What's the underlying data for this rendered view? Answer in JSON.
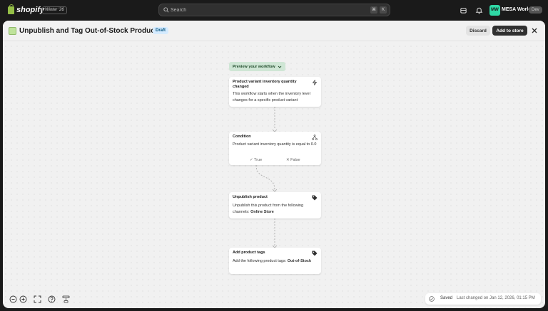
{
  "topbar": {
    "brand": "shopify",
    "version": "Winter '26",
    "search": {
      "placeholder": "Search",
      "shortcut_1": "⌘",
      "shortcut_2": "K"
    },
    "store": {
      "initials": "MW",
      "name": "MESA World",
      "badge": "Dev"
    }
  },
  "header": {
    "title": "Unpublish and Tag Out-of-Stock Products",
    "status": "Draft",
    "discard_label": "Discard",
    "add_label": "Add to store"
  },
  "canvas": {
    "preview_label": "Preview your workflow",
    "nodes": [
      {
        "title": "Product variant inventory quantity changed",
        "description": "This workflow starts when the inventory level changes for a specific product variant",
        "icon": "lightning-icon"
      },
      {
        "title": "Condition",
        "description": "Product variant inventory quantity is equal to 0.0",
        "icon": "branch-icon",
        "branches": {
          "true_label": "True",
          "false_label": "False"
        }
      },
      {
        "title": "Unpublish product",
        "description_prefix": "Unpublish this product from the following channels:",
        "description_bold": "Online Store",
        "icon": "tag-icon"
      },
      {
        "title": "Add product tags",
        "description_prefix": "Add the following product tags:",
        "description_bold": "Out-of-Stock",
        "icon": "tag-icon"
      }
    ]
  },
  "footer": {
    "saved_label": "Saved",
    "last_changed": "Last changed on Jan 12, 2026, 01:15 PM"
  },
  "colors": {
    "topbar_bg": "#1a1a1a",
    "canvas_bg": "#f1f1f1",
    "primary_button": "#303030",
    "preview_button": "#cfe6d5",
    "draft_badge": "#d5ebff",
    "avatar": "#2fd8a5"
  }
}
